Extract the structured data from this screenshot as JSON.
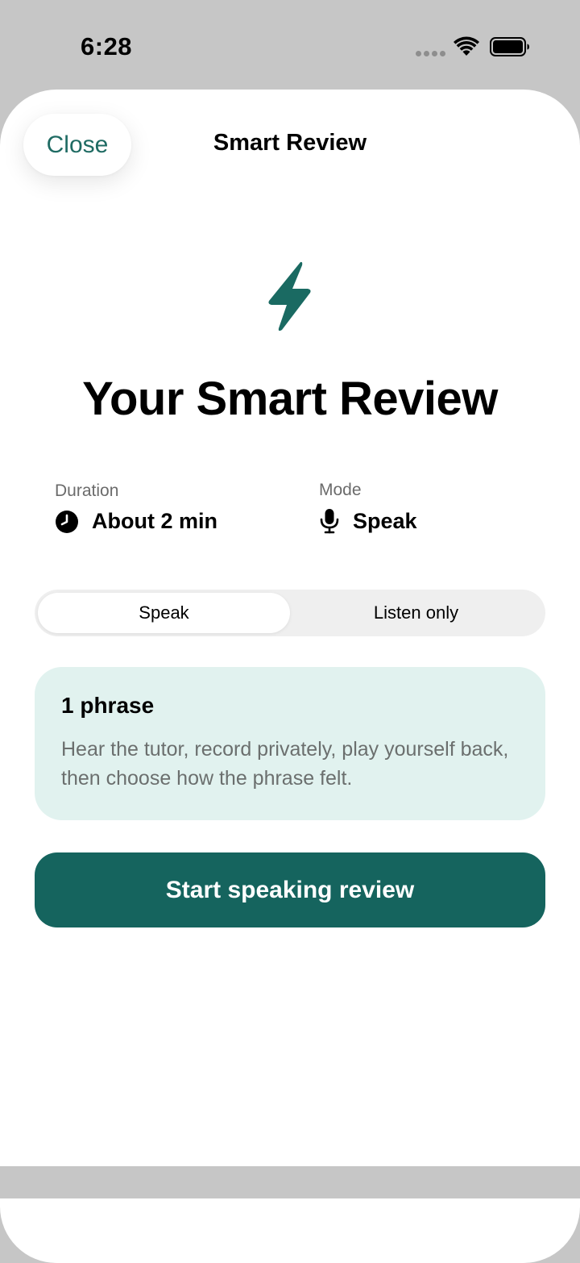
{
  "status_bar": {
    "time": "6:28"
  },
  "header": {
    "close_label": "Close",
    "title": "Smart Review"
  },
  "hero": {
    "icon": "bolt-icon",
    "title": "Your Smart Review"
  },
  "info": {
    "duration": {
      "label": "Duration",
      "value": "About 2 min",
      "icon": "clock-icon"
    },
    "mode": {
      "label": "Mode",
      "value": "Speak",
      "icon": "microphone-icon"
    }
  },
  "segmented": {
    "options": [
      "Speak",
      "Listen only"
    ],
    "selected": "Speak"
  },
  "card": {
    "title": "1 phrase",
    "body": "Hear the tutor, record privately, play yourself back, then choose how the phrase felt."
  },
  "start_button": {
    "label": "Start speaking review"
  },
  "colors": {
    "accent": "#15645e",
    "card_bg": "#e1f2ef",
    "close_text": "#1f6b63"
  }
}
